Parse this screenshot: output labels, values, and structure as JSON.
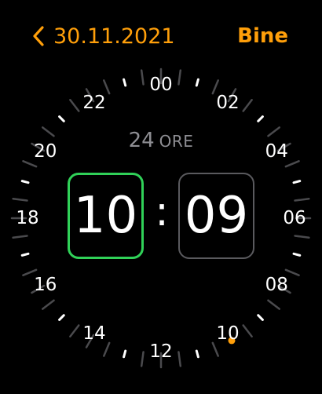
{
  "header": {
    "back_icon": "chevron-left-icon",
    "date_label": "30.11.2021",
    "done_label": "Bine",
    "accent_color": "#ff9f0a"
  },
  "dial": {
    "hour_labels": [
      "00",
      "02",
      "04",
      "06",
      "08",
      "10",
      "12",
      "14",
      "16",
      "18",
      "20",
      "22"
    ],
    "current_hour_marker_color": "#ff9f0a",
    "current_hour_marker_value": 10
  },
  "mode": {
    "number": "24",
    "unit": "ORE"
  },
  "time": {
    "hour": "10",
    "separator": ":",
    "minute": "09",
    "selected_field": "hour",
    "selected_color": "#30d158"
  }
}
